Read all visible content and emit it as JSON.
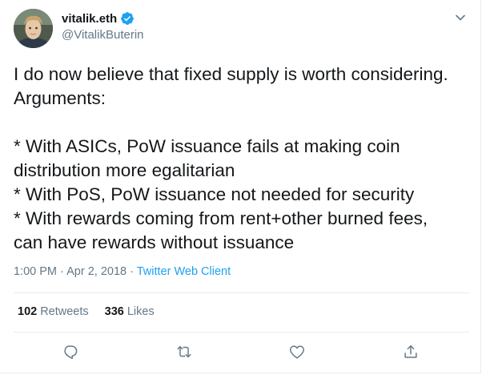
{
  "author": {
    "name": "vitalik.eth",
    "handle": "@VitalikButerin",
    "verified": true,
    "avatar": "avatar"
  },
  "tweet": {
    "text": "I do now believe that fixed supply is worth considering.\nArguments:\n\n* With ASICs, PoW issuance fails at making coin\ndistribution more egalitarian\n* With PoS, PoW issuance not needed for security\n* With rewards coming from rent+other burned fees,\ncan have rewards without issuance",
    "time": "1:00 PM",
    "date": "Apr 2, 2018",
    "separator": "·",
    "source": "Twitter Web Client"
  },
  "stats": {
    "retweets_count": "102",
    "retweets_label": "Retweets",
    "likes_count": "336",
    "likes_label": "Likes"
  },
  "icons": {
    "menu": "chevron-down-icon",
    "verified": "verified-badge-icon",
    "reply": "reply-icon",
    "retweet": "retweet-icon",
    "like": "heart-icon",
    "share": "share-icon"
  },
  "colors": {
    "accent": "#1da1f2",
    "text": "#14171a",
    "muted": "#657786",
    "border": "#e6ecf0"
  }
}
